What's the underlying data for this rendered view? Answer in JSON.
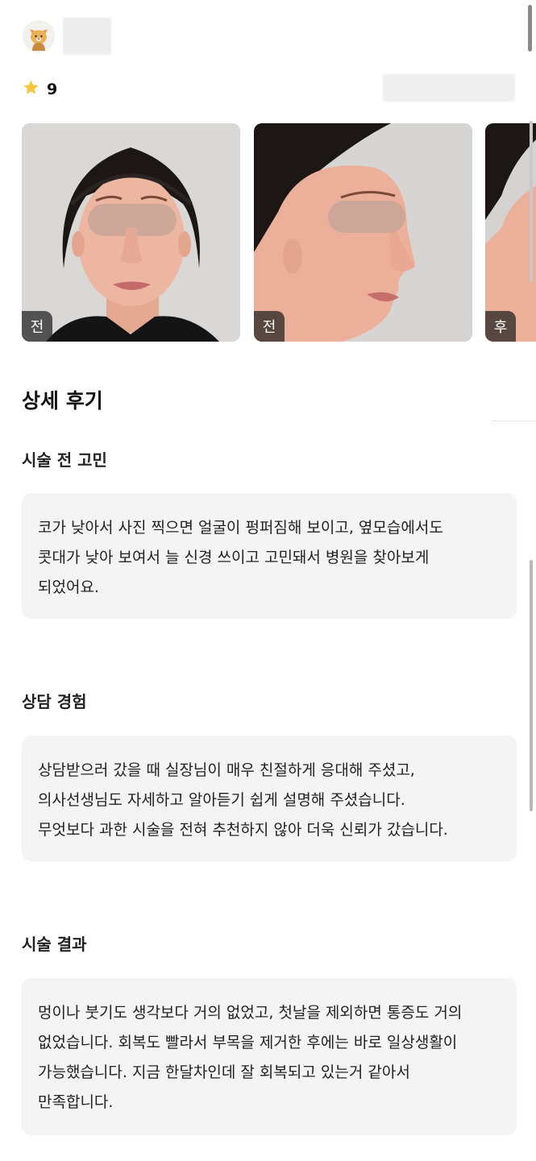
{
  "rating": {
    "value": "9"
  },
  "photos": [
    {
      "tag": "전",
      "view": "front"
    },
    {
      "tag": "전",
      "view": "side"
    },
    {
      "tag": "후",
      "view": "side"
    }
  ],
  "detail": {
    "title": "상세 후기",
    "sections": [
      {
        "title": "시술 전 고민",
        "lines": [
          "코가 낮아서 사진 찍으면 얼굴이 펑퍼짐해 보이고, 옆모습에서도",
          "콧대가 낮아 보여서 늘 신경 쓰이고 고민돼서 병원을 찾아보게",
          "되었어요."
        ]
      },
      {
        "title": "상담 경험",
        "lines": [
          "상담받으러 갔을 때 실장님이 매우 친절하게 응대해 주셨고,",
          "의사선생님도 자세하고 알아듣기 쉽게 설명해 주셨습니다.",
          "무엇보다 과한 시술을 전혀 추천하지 않아 더욱 신뢰가 갔습니다."
        ]
      },
      {
        "title": "시술 결과",
        "lines": [
          "멍이나 붓기도 생각보다 거의 없었고, 첫날을 제외하면 통증도 거의",
          "없었습니다. 회복도 빨라서 부목을 제거한 후에는 바로 일상생활이",
          "가능했습니다. 지금 한달차인데 잘 회복되고 있는거 같아서",
          "만족합니다."
        ]
      }
    ]
  },
  "icons": {
    "avatar": "cat-avatar-icon",
    "rating": "star-icon"
  },
  "colors": {
    "star": "#F9C43F",
    "box_background": "#F4F4F4",
    "photo_tag_background": "#1E1E1E"
  }
}
